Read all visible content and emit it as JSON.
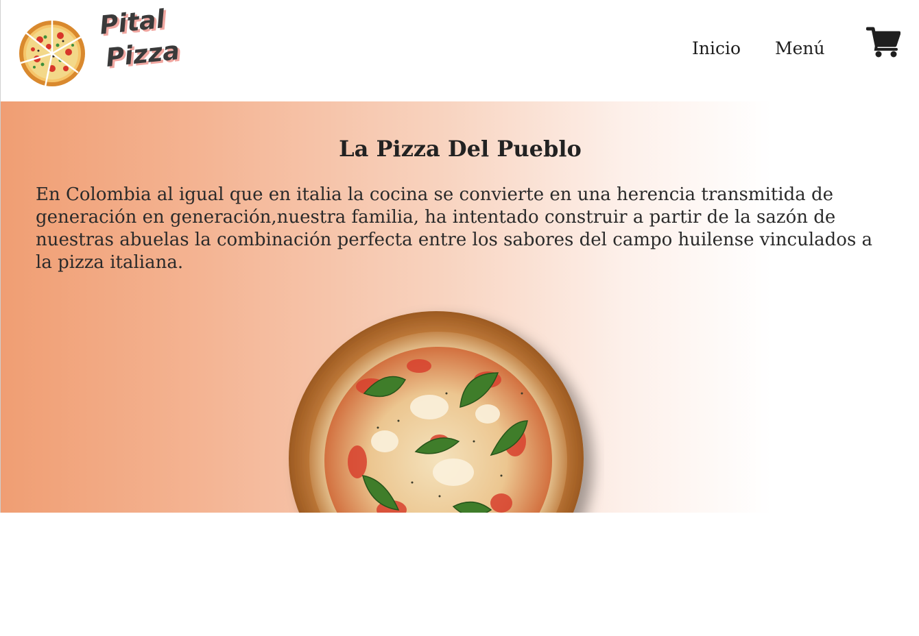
{
  "brand": {
    "name_line1": "Pital",
    "name_line2": "Pizza",
    "logo_icon": "pizza-slices-icon"
  },
  "nav": {
    "items": [
      "Inicio",
      "Menú"
    ],
    "cart_icon": "shopping-cart-icon"
  },
  "hero": {
    "title": "La Pizza Del Pueblo",
    "text": "En Colombia al igual que en italia la cocina se convierte en una herencia transmitida de generación en generación,nuestra familia, ha intentado construir a partir de la sazón de nuestras abuelas la combinación perfecta entre los sabores del campo huilense vinculados a la pizza italiana.",
    "image": "margherita-pizza-on-wooden-board"
  },
  "colors": {
    "gradient_start": "#f09e73",
    "gradient_end": "#ffffff",
    "logo_shadow": "#f1a7a1",
    "text": "#222222"
  }
}
